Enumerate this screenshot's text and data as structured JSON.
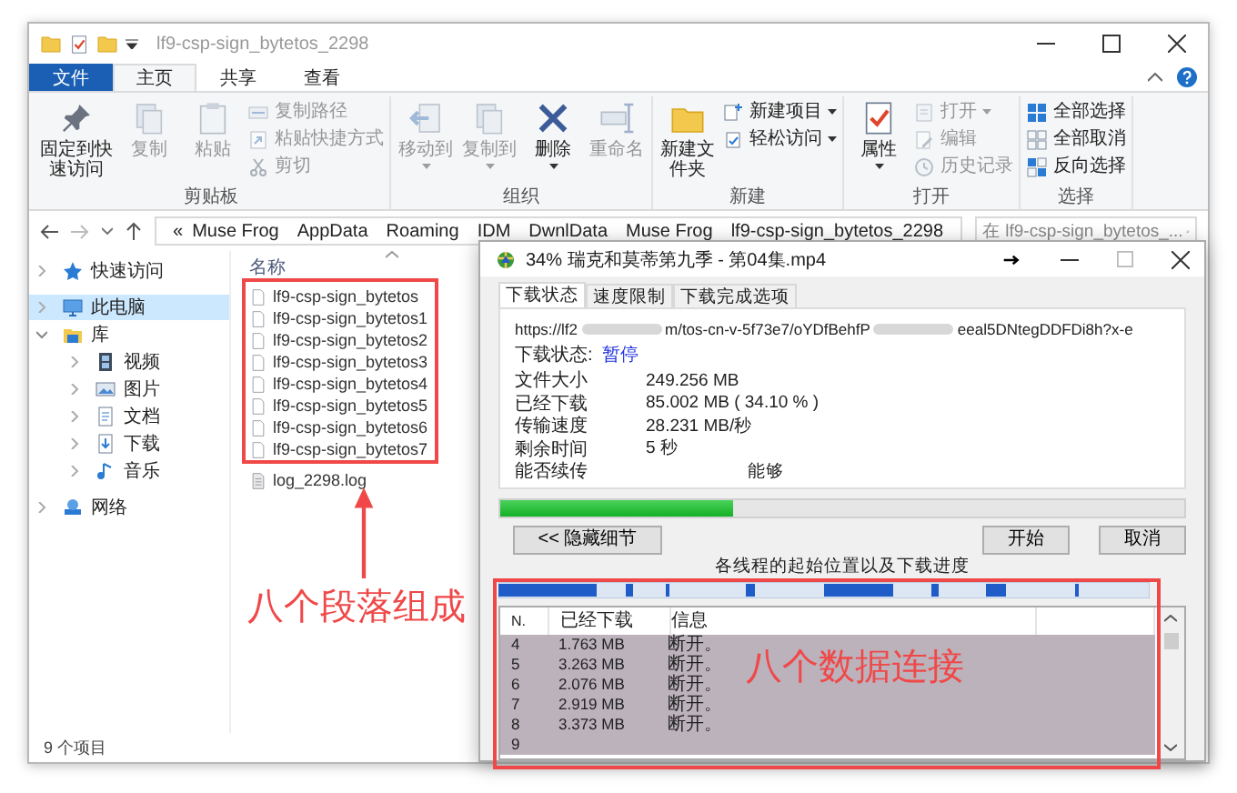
{
  "explorer": {
    "title": "lf9-csp-sign_bytetos_2298",
    "ribbon_tabs": [
      {
        "label": "文件",
        "kind": "file",
        "selected": false
      },
      {
        "label": "主页",
        "kind": "tab",
        "selected": true
      },
      {
        "label": "共享",
        "kind": "tab",
        "selected": false
      },
      {
        "label": "查看",
        "kind": "tab",
        "selected": false
      }
    ],
    "ribbon_groups": [
      {
        "label": "剪贴板",
        "columns": [
          {
            "kind": "large",
            "label": "固定到快速访问",
            "disabled": false,
            "dropdown": false
          },
          {
            "kind": "large",
            "label": "复制",
            "disabled": true,
            "dropdown": false
          },
          {
            "kind": "large",
            "label": "粘贴",
            "disabled": true,
            "dropdown": false
          },
          {
            "kind": "stack",
            "items": [
              {
                "label": "复制路径",
                "disabled": true,
                "dropdown": false
              },
              {
                "label": "粘贴快捷方式",
                "disabled": true,
                "dropdown": false
              },
              {
                "label": "剪切",
                "disabled": true,
                "dropdown": false
              }
            ]
          }
        ]
      },
      {
        "label": "组织",
        "columns": [
          {
            "kind": "large",
            "label": "移动到",
            "disabled": true,
            "dropdown": true
          },
          {
            "kind": "large",
            "label": "复制到",
            "disabled": true,
            "dropdown": true
          },
          {
            "kind": "large",
            "label": "删除",
            "disabled": false,
            "dropdown": true
          },
          {
            "kind": "large",
            "label": "重命名",
            "disabled": true,
            "dropdown": false
          }
        ]
      },
      {
        "label": "新建",
        "columns": [
          {
            "kind": "large",
            "label": "新建文件夹",
            "disabled": false,
            "dropdown": false
          },
          {
            "kind": "stack",
            "items": [
              {
                "label": "新建项目",
                "disabled": false,
                "dropdown": true
              },
              {
                "label": "轻松访问",
                "disabled": false,
                "dropdown": true
              }
            ]
          }
        ]
      },
      {
        "label": "打开",
        "columns": [
          {
            "kind": "large",
            "label": "属性",
            "disabled": false,
            "dropdown": true
          },
          {
            "kind": "stack",
            "items": [
              {
                "label": "打开",
                "disabled": true,
                "dropdown": true
              },
              {
                "label": "编辑",
                "disabled": true,
                "dropdown": false
              },
              {
                "label": "历史记录",
                "disabled": true,
                "dropdown": false
              }
            ]
          }
        ]
      },
      {
        "label": "选择",
        "columns": [
          {
            "kind": "stack",
            "items": [
              {
                "label": "全部选择",
                "disabled": false,
                "dropdown": false
              },
              {
                "label": "全部取消",
                "disabled": false,
                "dropdown": false
              },
              {
                "label": "反向选择",
                "disabled": false,
                "dropdown": false
              }
            ]
          }
        ]
      }
    ],
    "breadcrumbs": [
      "«",
      "Muse Frog",
      "AppData",
      "Roaming",
      "IDM",
      "DwnlData",
      "Muse Frog",
      "lf9-csp-sign_bytetos_2298"
    ],
    "search": {
      "placeholder": "在 lf9-csp-sign_bytetos_..."
    },
    "nav": [
      {
        "label": "快速访问",
        "selected": false,
        "expanded": false
      },
      {
        "label": "此电脑",
        "selected": true,
        "expanded": false
      },
      {
        "label": "库",
        "selected": false,
        "expanded": true,
        "children": [
          {
            "label": "视频",
            "selected": false,
            "expanded": false
          },
          {
            "label": "图片",
            "selected": false,
            "expanded": false
          },
          {
            "label": "文档",
            "selected": false,
            "expanded": false
          },
          {
            "label": "下载",
            "selected": false,
            "expanded": false
          },
          {
            "label": "音乐",
            "selected": false,
            "expanded": false
          }
        ]
      },
      {
        "label": "网络",
        "selected": false,
        "expanded": false
      }
    ],
    "file_list": {
      "column": "名称",
      "files": [
        {
          "name": "lf9-csp-sign_bytetos",
          "kind": "file"
        },
        {
          "name": "lf9-csp-sign_bytetos1",
          "kind": "file"
        },
        {
          "name": "lf9-csp-sign_bytetos2",
          "kind": "file"
        },
        {
          "name": "lf9-csp-sign_bytetos3",
          "kind": "file"
        },
        {
          "name": "lf9-csp-sign_bytetos4",
          "kind": "file"
        },
        {
          "name": "lf9-csp-sign_bytetos5",
          "kind": "file"
        },
        {
          "name": "lf9-csp-sign_bytetos6",
          "kind": "file"
        },
        {
          "name": "lf9-csp-sign_bytetos7",
          "kind": "file"
        },
        {
          "name": "log_2298.log",
          "kind": "log"
        }
      ]
    },
    "status_bar": "9 个项目"
  },
  "download_dialog": {
    "title": "34% 瑞克和莫蒂第九季 - 第04集.mp4",
    "tabs": [
      {
        "label": "下载状态",
        "selected": true
      },
      {
        "label": "速度限制",
        "selected": false
      },
      {
        "label": "下载完成选项",
        "selected": false
      }
    ],
    "url_parts": [
      "https://lf2",
      "m/tos-cn-v-5f73e7/oYDfBehfP",
      "eeal5DNtegDDFDi8h?x-e"
    ],
    "status_label": "下载状态:",
    "status_value": "暂停",
    "info": [
      {
        "label": "文件大小",
        "value": "249.256  MB"
      },
      {
        "label": "已经下载",
        "value": "85.002  MB ( 34.10 % )"
      },
      {
        "label": "传输速度",
        "value": "28.231  MB/秒"
      },
      {
        "label": "剩余时间",
        "value": "5 秒"
      },
      {
        "label": "能否续传",
        "value": "能够",
        "kind": "offset"
      }
    ],
    "progress": {
      "level": 0.34
    },
    "buttons": {
      "details": "<< 隐藏细节",
      "start": "开始",
      "cancel": "取消"
    },
    "threads_label": "各线程的起始位置以及下载进度",
    "table": {
      "columns": [
        "N.",
        "已经下载",
        "信息"
      ],
      "rows": [
        {
          "n": "4",
          "downloaded": "1.763  MB",
          "info": "断开。",
          "selected": true
        },
        {
          "n": "5",
          "downloaded": "3.263  MB",
          "info": "断开。",
          "selected": true
        },
        {
          "n": "6",
          "downloaded": "2.076  MB",
          "info": "断开。",
          "selected": true
        },
        {
          "n": "7",
          "downloaded": "2.919  MB",
          "info": "断开。",
          "selected": true
        },
        {
          "n": "8",
          "downloaded": "3.373  MB",
          "info": "断开。",
          "selected": true
        },
        {
          "n": "9",
          "selected": true
        }
      ]
    }
  },
  "annotations": [
    {
      "text": "八个段落组成"
    },
    {
      "text": "八个数据连接"
    }
  ]
}
